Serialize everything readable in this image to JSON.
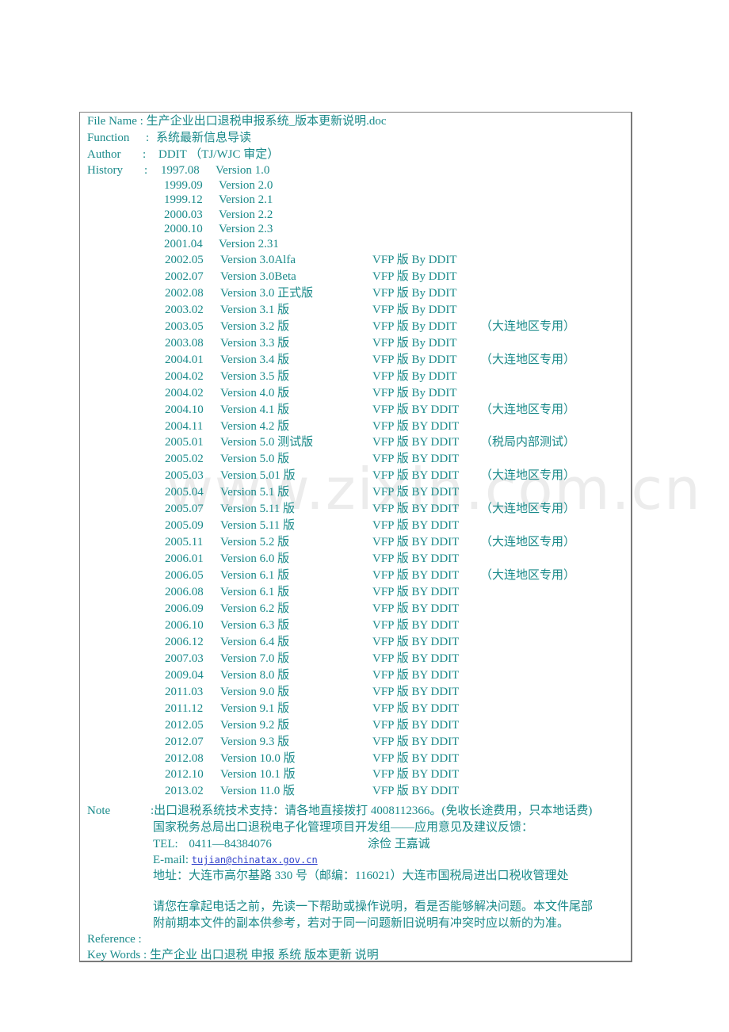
{
  "header": {
    "file_name_label": "File Name :",
    "file_name_value": "生产企业出口退税申报系统_版本更新说明.doc",
    "function_label": "Function",
    "function_colon": ":",
    "function_value": "系统最新信息导读",
    "author_label": "Author",
    "author_colon": ":",
    "author_value": "DDIT （TJ/WJC 审定）",
    "history_label": "History",
    "history_colon": ":"
  },
  "history": [
    {
      "date": "1997.08",
      "version": "Version 1.0",
      "by": "",
      "note": ""
    },
    {
      "date": "1999.09",
      "version": "Version 2.0",
      "by": "",
      "note": ""
    },
    {
      "date": "1999.12",
      "version": "Version 2.1",
      "by": "",
      "note": ""
    },
    {
      "date": "2000.03",
      "version": "Version 2.2",
      "by": "",
      "note": ""
    },
    {
      "date": "2000.10",
      "version": "Version 2.3",
      "by": "",
      "note": ""
    },
    {
      "date": "2001.04",
      "version": "Version 2.31",
      "by": "",
      "note": ""
    },
    {
      "date": "2002.05",
      "version": "Version 3.0Alfa",
      "by": "VFP  版  By DDIT",
      "note": ""
    },
    {
      "date": "2002.07",
      "version": "Version 3.0Beta",
      "by": "VFP  版  By DDIT",
      "note": ""
    },
    {
      "date": "2002.08",
      "version": "Version 3.0 正式版",
      "by": "VFP  版  By DDIT",
      "note": ""
    },
    {
      "date": "2003.02",
      "version": "Version 3.1 版",
      "by": "VFP  版  By DDIT",
      "note": ""
    },
    {
      "date": "2003.05",
      "version": "Version 3.2 版",
      "by": "VFP  版 By DDIT",
      "note": "（大连地区专用）"
    },
    {
      "date": "2003.08",
      "version": "Version 3.3 版",
      "by": "VFP  版 By DDIT",
      "note": ""
    },
    {
      "date": "2004.01",
      "version": "Version 3.4 版",
      "by": "VFP  版 By DDIT",
      "note": "（大连地区专用）"
    },
    {
      "date": "2004.02",
      "version": "Version 3.5 版",
      "by": "VFP  版 By DDIT",
      "note": ""
    },
    {
      "date": "2004.02",
      "version": "Version 4.0 版",
      "by": "VFP  版 By DDIT",
      "note": ""
    },
    {
      "date": "2004.10",
      "version": "Version 4.1 版",
      "by": "VFP  版 BY DDIT",
      "note": "（大连地区专用）"
    },
    {
      "date": "2004.11",
      "version": "Version 4.2 版",
      "by": "VFP  版 BY DDIT",
      "note": ""
    },
    {
      "date": "2005.01",
      "version": "Version 5.0 测试版",
      "by": "VFP  版 BY DDIT",
      "note": "（税局内部测试）"
    },
    {
      "date": "2005.02",
      "version": "Version 5.0 版",
      "by": "VFP  版 BY DDIT",
      "note": ""
    },
    {
      "date": "2005.03",
      "version": "Version 5.01 版",
      "by": "VFP  版 BY DDIT",
      "note": "（大连地区专用）"
    },
    {
      "date": "2005.04",
      "version": "Version 5.1 版",
      "by": "VFP  版 BY DDIT",
      "note": ""
    },
    {
      "date": "2005.07",
      "version": "Version 5.11 版",
      "by": "VFP  版 BY DDIT",
      "note": "（大连地区专用）"
    },
    {
      "date": "2005.09",
      "version": "Version 5.11 版",
      "by": "VFP  版 BY DDIT",
      "note": ""
    },
    {
      "date": "2005.11",
      "version": "Version 5.2 版",
      "by": "VFP  版 BY DDIT",
      "note": "（大连地区专用）"
    },
    {
      "date": "2006.01",
      "version": "Version 6.0 版",
      "by": "VFP  版 BY DDIT",
      "note": ""
    },
    {
      "date": "2006.05",
      "version": "Version 6.1 版",
      "by": "VFP  版 BY DDIT",
      "note": "（大连地区专用）"
    },
    {
      "date": "2006.08",
      "version": "Version 6.1 版",
      "by": "VFP  版 BY DDIT",
      "note": ""
    },
    {
      "date": "2006.09",
      "version": "Version 6.2 版",
      "by": "VFP  版 BY DDIT",
      "note": ""
    },
    {
      "date": "2006.10",
      "version": "Version 6.3 版",
      "by": "VFP  版 BY DDIT",
      "note": ""
    },
    {
      "date": "2006.12",
      "version": "Version 6.4 版",
      "by": "VFP  版 BY DDIT",
      "note": ""
    },
    {
      "date": "2007.03",
      "version": "Version 7.0 版",
      "by": "VFP  版 BY DDIT",
      "note": ""
    },
    {
      "date": "2009.04",
      "version": "Version 8.0 版",
      "by": "VFP  版 BY DDIT",
      "note": ""
    },
    {
      "date": "2011.03",
      "version": "Version 9.0 版",
      "by": "VFP  版 BY DDIT",
      "note": ""
    },
    {
      "date": "2011.12",
      "version": "Version 9.1 版",
      "by": "VFP  版 BY DDIT",
      "note": ""
    },
    {
      "date": "2012.05",
      "version": "Version 9.2 版",
      "by": "VFP  版 BY DDIT",
      "note": ""
    },
    {
      "date": "2012.07",
      "version": "Version 9.3 版",
      "by": "VFP  版 BY DDIT",
      "note": ""
    },
    {
      "date": "2012.08",
      "version": "Version 10.0 版",
      "by": "VFP  版 BY DDIT",
      "note": ""
    },
    {
      "date": "2012.10",
      "version": "Version 10.1 版",
      "by": "VFP  版 BY DDIT",
      "note": ""
    },
    {
      "date": "2013.02",
      "version": "Version 11.0 版",
      "by": "VFP  版 BY DDIT",
      "note": ""
    }
  ],
  "note": {
    "label": "Note",
    "line1": ":出口退税系统技术支持：请各地直接拨打 4008112366。(免收长途费用，只本地话费)",
    "line2": "国家税务总局出口退税电子化管理项目开发组——应用意见及建议反馈：",
    "tel_label": "TEL:",
    "tel_value": "0411—84384076",
    "contacts": "涂俭    王嘉诚",
    "email_label": "E-mail:",
    "email_value": "tujian@chinatax.gov.cn",
    "address": "地址：大连市高尔基路 330 号（邮编：116021）大连市国税局进出口税收管理处",
    "para1": "请您在拿起电话之前，先读一下帮助或操作说明，看是否能够解决问题。本文件尾部",
    "para2": "附前期本文件的副本供参考，若对于同一问题新旧说明有冲突时应以新的为准。"
  },
  "footer": {
    "reference_label": "Reference :",
    "keywords_label": "Key Words :",
    "keywords_value": "生产企业  出口退税  申报  系统  版本更新  说明"
  },
  "watermark": "www.zixin.com.cn"
}
